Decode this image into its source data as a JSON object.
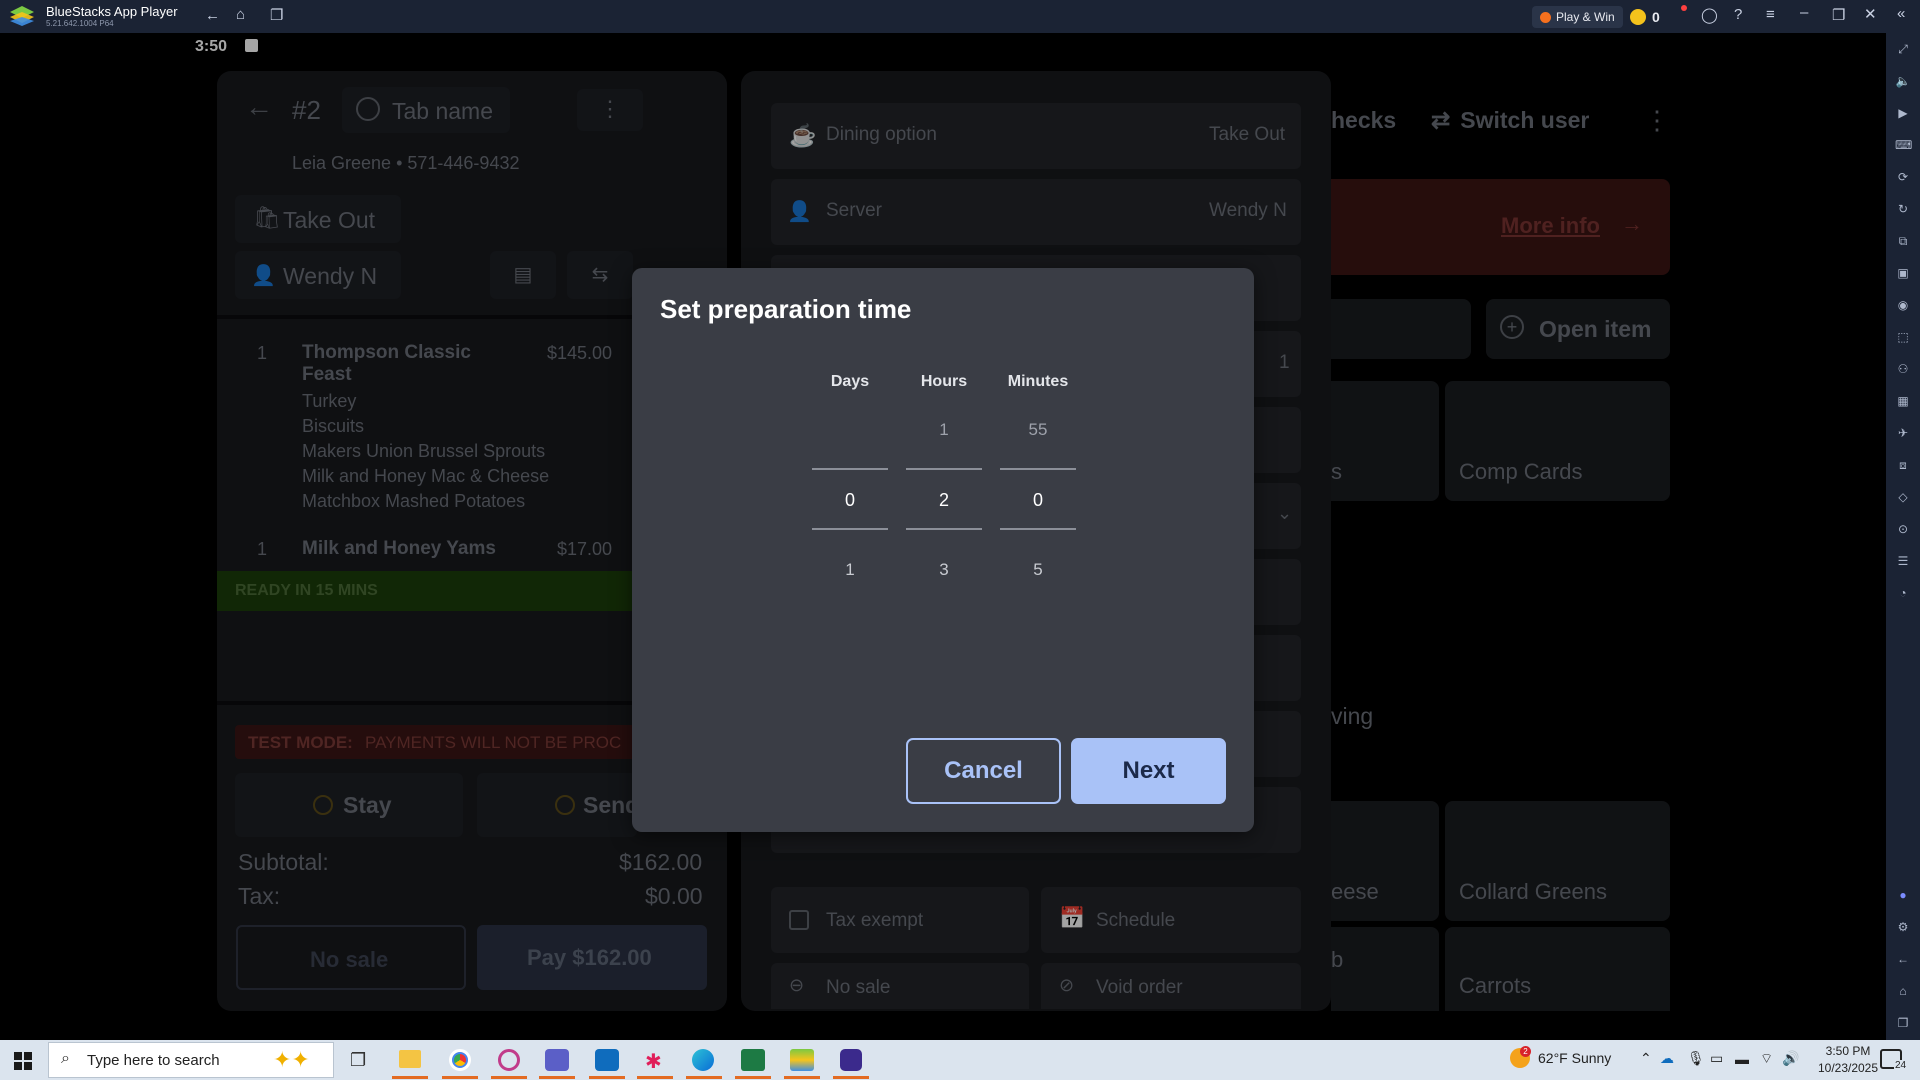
{
  "titlebar": {
    "app_name": "BlueStacks App Player",
    "version": "5.21.642.1004  P64",
    "play_win": "Play & Win",
    "coins": "0"
  },
  "status": {
    "time": "3:50"
  },
  "order": {
    "number": "#2",
    "tab_name": "Tab name",
    "customer": "Leia Greene • 571-446-9432",
    "dining": "Take Out",
    "server": "Wendy N",
    "items": [
      {
        "qty": "1",
        "name": "Thompson Classic",
        "name2": "Feast",
        "price": "$145.00",
        "mods": [
          "Turkey",
          "Biscuits",
          "Makers Union Brussel Sprouts",
          "Milk and Honey Mac & Cheese",
          "Matchbox Mashed Potatoes"
        ]
      },
      {
        "qty": "1",
        "name": "Milk and Honey Yams",
        "price": "$17.00"
      }
    ],
    "ready": "READY IN 15 MINS",
    "test_mode": "TEST MODE:",
    "test_mode_msg": "PAYMENTS WILL NOT BE PROC",
    "stay": "Stay",
    "send": "Send",
    "subtotal_label": "Subtotal:",
    "subtotal": "$162.00",
    "tax_label": "Tax:",
    "tax": "$0.00",
    "no_sale": "No sale",
    "pay": "Pay $162.00"
  },
  "options": {
    "dining_label": "Dining option",
    "dining_value": "Take Out",
    "server_label": "Server",
    "server_value": "Wendy N",
    "one": "1",
    "tax_exempt": "Tax exempt",
    "schedule": "Schedule",
    "no_sale": "No sale",
    "void_order": "Void order"
  },
  "right": {
    "checks": "hecks",
    "switch_user": "Switch user",
    "more_info": "More info",
    "open_item": "Open item",
    "s_frag": "s",
    "comp_cards": "Comp Cards",
    "ving": "ving",
    "eese": "eese",
    "collard": "Collard Greens",
    "b_frag": "b",
    "carrots": "Carrots"
  },
  "dialog": {
    "title": "Set preparation time",
    "headers": [
      "Days",
      "Hours",
      "Minutes"
    ],
    "above": [
      "",
      "1",
      "55"
    ],
    "selected": [
      "0",
      "2",
      "0"
    ],
    "below": [
      "1",
      "3",
      "5"
    ],
    "cancel": "Cancel",
    "next": "Next"
  },
  "taskbar": {
    "search_placeholder": "Type here to search",
    "weather": "62°F  Sunny",
    "weather_badge": "2",
    "time": "3:50 PM",
    "date": "10/23/2025",
    "notif": "24"
  },
  "colors": {
    "accent": "#a9c2f7",
    "ready_green": "#1b3c0a",
    "test_red": "#3a1514",
    "more_info_bg": "#3b1413"
  }
}
